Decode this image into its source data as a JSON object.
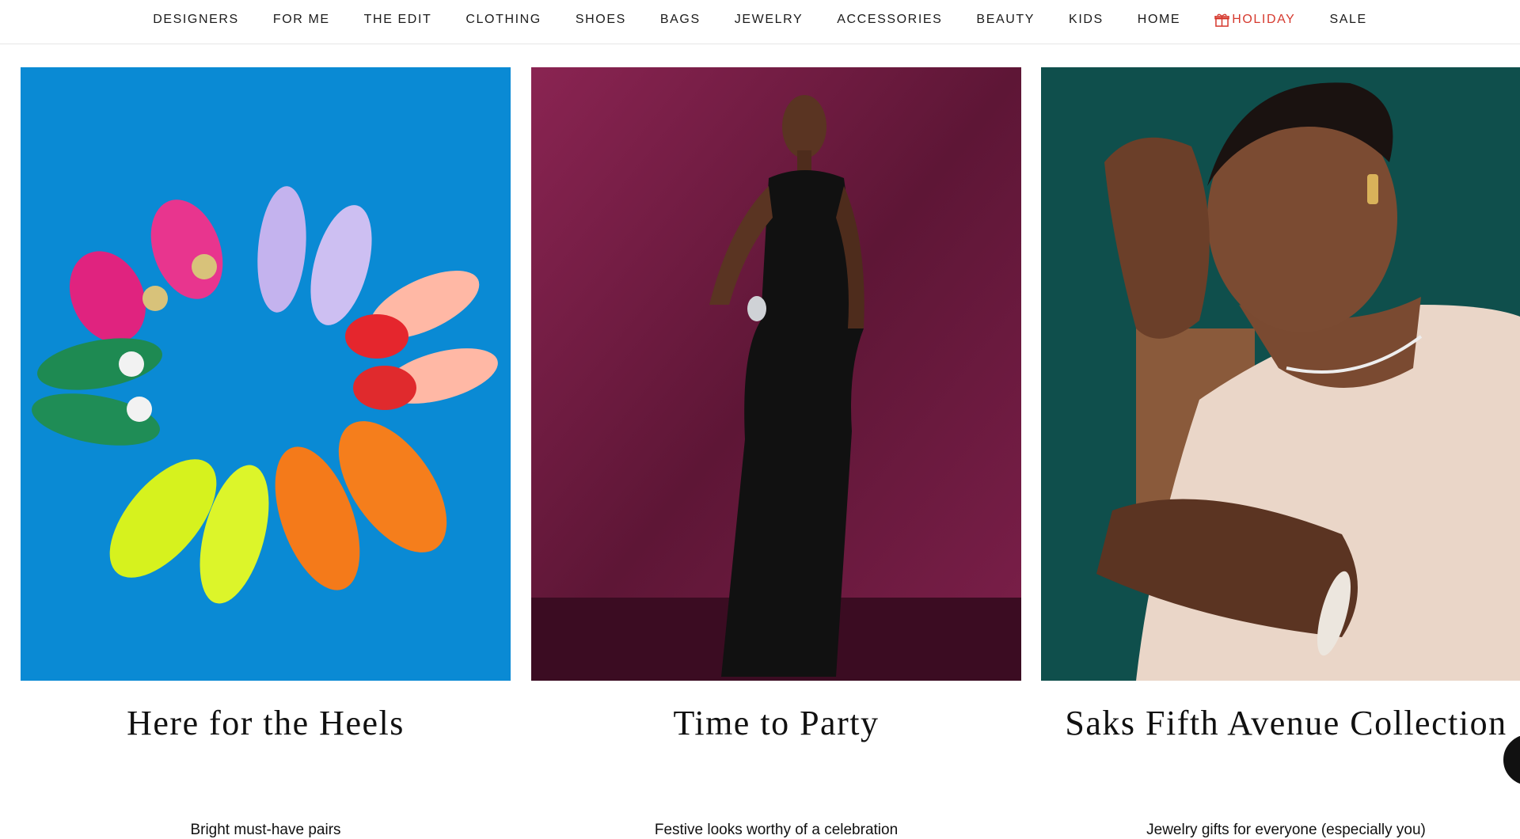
{
  "nav": {
    "items": [
      {
        "label": "DESIGNERS"
      },
      {
        "label": "FOR ME"
      },
      {
        "label": "THE EDIT"
      },
      {
        "label": "CLOTHING"
      },
      {
        "label": "SHOES"
      },
      {
        "label": "BAGS"
      },
      {
        "label": "JEWELRY"
      },
      {
        "label": "ACCESSORIES"
      },
      {
        "label": "BEAUTY"
      },
      {
        "label": "KIDS"
      },
      {
        "label": "HOME"
      },
      {
        "label": "HOLIDAY",
        "icon": "gift-icon",
        "color": "#d63a2f"
      },
      {
        "label": "SALE"
      }
    ]
  },
  "tiles": [
    {
      "title": "Here for the Heels",
      "subtitle": "Bright must-have pairs",
      "image": "heels-on-blue-photo",
      "bg_color": "#0a8ad4"
    },
    {
      "title": "Time to Party",
      "subtitle": "Festive looks worthy of a celebration",
      "image": "sequin-gown-model-photo",
      "bg_color": "#6b1a3c"
    },
    {
      "title": "Saks Fifth Avenue Collection",
      "subtitle": "Jewelry gifts for everyone (especially you)",
      "image": "jewelry-model-photo",
      "bg_color": "#0f4f4c"
    }
  ],
  "chat": {
    "icon": "chat-icon"
  }
}
